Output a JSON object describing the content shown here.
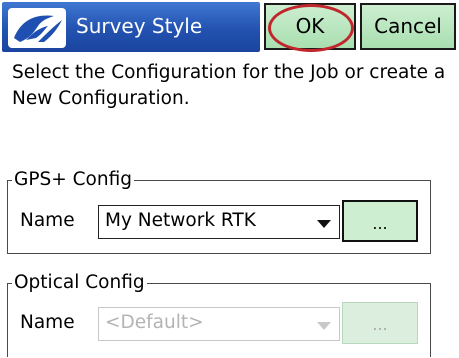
{
  "window": {
    "title": "Survey Style",
    "ok_label": "OK",
    "cancel_label": "Cancel"
  },
  "instruction": "Select the Configuration for the Job or create a New Configuration.",
  "gps_config": {
    "legend": "GPS+ Config",
    "name_label": "Name",
    "selected": "My Network RTK",
    "browse_label": "..."
  },
  "optical_config": {
    "legend": "Optical Config",
    "name_label": "Name",
    "selected": "<Default>",
    "browse_label": "..."
  },
  "colors": {
    "titlebar": "#2352b0",
    "button_bg": "#cdeed0",
    "highlight_circle": "#c0262c"
  },
  "icons": {
    "app_logo": "logo-icon",
    "dropdown": "chevron-down-icon"
  }
}
